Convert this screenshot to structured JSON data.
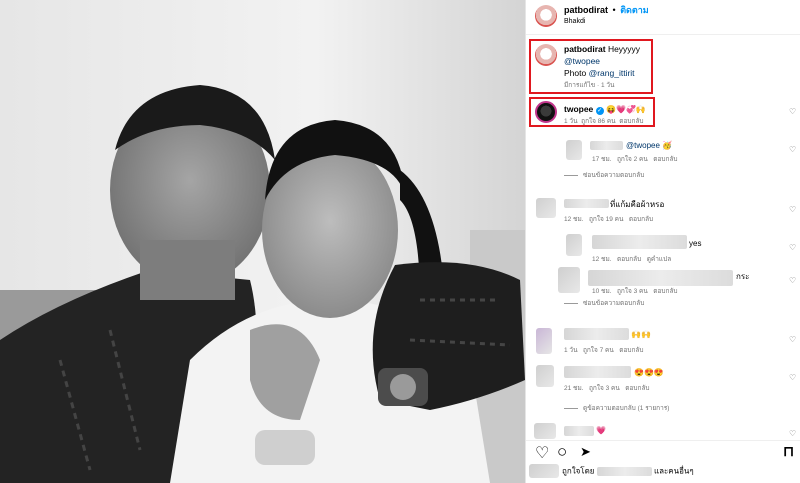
{
  "post": {
    "author": "patbodirat",
    "dot": "•",
    "follow_label": "ติดตาม",
    "location": "Bhakdi"
  },
  "caption": {
    "username": "patbodirat",
    "text": "Heyyyyy",
    "mention": "@twopee",
    "photo_prefix": "Photo",
    "photo_credit": "@rang_ittirit",
    "meta": "มีการแก้ไข · 1 วัน"
  },
  "comments": [
    {
      "username": "twopee",
      "emoji": "😝💗💞🙌",
      "time": "1 วัน",
      "likes": "ถูกใจ 86 คน",
      "reply": "ตอบกลับ"
    },
    {
      "text": "@twopee 🥳",
      "time": "17 ชม.",
      "likes": "ถูกใจ 2 คน",
      "reply": "ตอบกลับ"
    },
    {
      "toggle": "ซ่อนข้อความตอบกลับ"
    },
    {
      "text": "ที่แก้มคือผ้าหรอ",
      "time": "12 ชม.",
      "likes": "ถูกใจ 19 คน",
      "reply": "ตอบกลับ"
    },
    {
      "text": "yes",
      "time": "12 ชม.",
      "likes": "ตอบกลับ",
      "reply": "ดูคำแปล"
    },
    {
      "text": "กระ",
      "time": "10 ชม.",
      "likes": "ถูกใจ 3 คน",
      "reply": "ตอบกลับ"
    },
    {
      "toggle": "ซ่อนข้อความตอบกลับ"
    },
    {
      "text": "🙌🙌",
      "time": "1 วัน",
      "likes": "ถูกใจ 7 คน",
      "reply": "ตอบกลับ"
    },
    {
      "text": "😍😍😍",
      "time": "21 ชม.",
      "likes": "ถูกใจ 3 คน",
      "reply": "ตอบกลับ"
    },
    {
      "toggle": "ดูข้อความตอบกลับ (1 รายการ)"
    },
    {
      "text": "💗"
    }
  ],
  "footer": {
    "liked_by_prefix": "ถูกใจโดย",
    "liked_by_suffix": "และคนอื่นๆ"
  },
  "icons": {
    "heart": "♡",
    "comment": "○",
    "share": "➤",
    "bookmark": "⊓",
    "verified": "✓",
    "small_heart": "♡"
  },
  "colors": {
    "highlight": "#e0181f",
    "link": "#00376b",
    "follow": "#0095f6"
  }
}
